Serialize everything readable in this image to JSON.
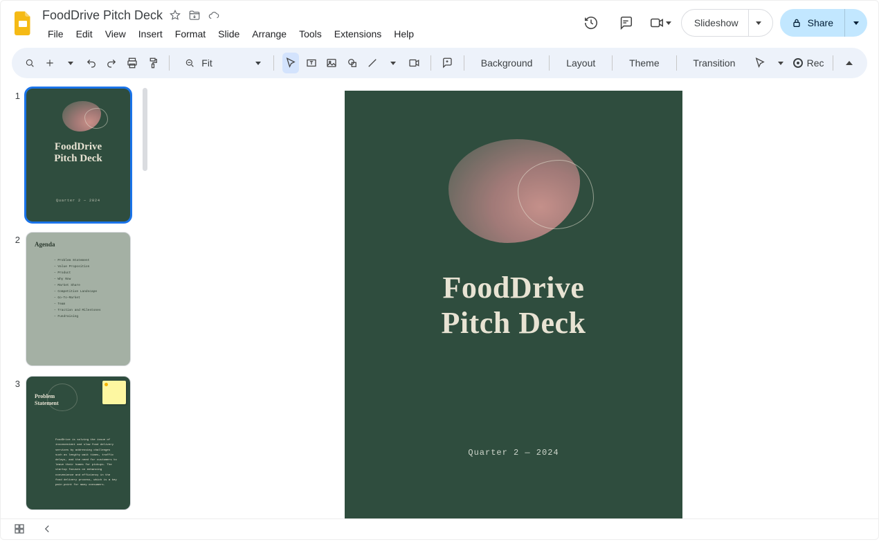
{
  "doc": {
    "title": "FoodDrive Pitch Deck"
  },
  "menu": {
    "file": "File",
    "edit": "Edit",
    "view": "View",
    "insert": "Insert",
    "format": "Format",
    "slide": "Slide",
    "arrange": "Arrange",
    "tools": "Tools",
    "extensions": "Extensions",
    "help": "Help"
  },
  "header": {
    "slideshow": "Slideshow",
    "share": "Share"
  },
  "toolbar": {
    "zoom": "Fit",
    "background": "Background",
    "layout": "Layout",
    "theme": "Theme",
    "transition": "Transition",
    "rec": "Rec"
  },
  "thumbs": {
    "n1": "1",
    "n2": "2",
    "n3": "3",
    "t1_title_l1": "FoodDrive",
    "t1_title_l2": "Pitch Deck",
    "t1_sub": "Quarter 2 — 2024",
    "t2_title": "Agenda",
    "t2_items": {
      "i1": "Problem Statement",
      "i2": "Value Proposition",
      "i3": "Product",
      "i4": "Why Now",
      "i5": "Market Share",
      "i6": "Competitive Landscape",
      "i7": "Go-To-Market",
      "i8": "Team",
      "i9": "Traction and Milestones",
      "i10": "Fundraising"
    },
    "t3_title_l1": "Problem",
    "t3_title_l2": "Statement",
    "t3_body": "FoodDrive is solving the issue of inconvenient and slow food delivery services by addressing challenges such as lengthy wait times, traffic delays, and the need for customers to leave their homes for pickups. The startup focuses on enhancing convenience and efficiency in the food delivery process, which is a key pain point for many consumers."
  },
  "slide": {
    "title_l1": "FoodDrive",
    "title_l2": "Pitch Deck",
    "subtitle": "Quarter 2 — 2024"
  }
}
